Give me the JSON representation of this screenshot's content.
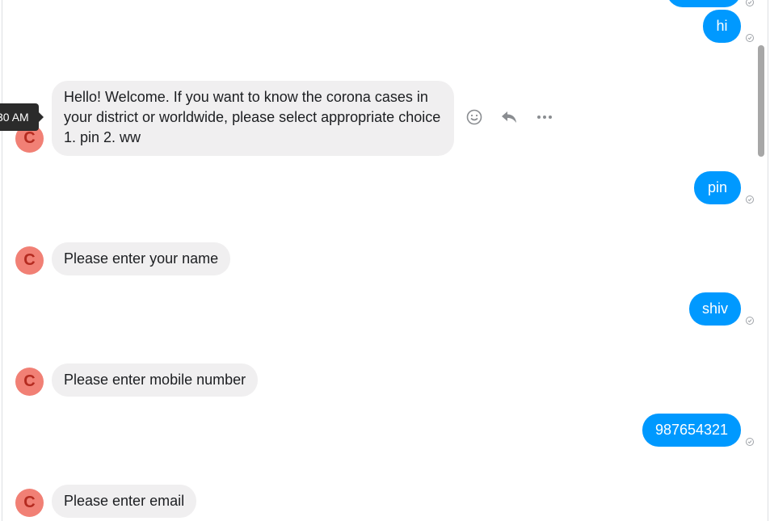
{
  "tooltip": {
    "time": "30 AM"
  },
  "avatar_initial": "C",
  "messages": {
    "out_hi": "hi",
    "bot_welcome": "Hello! Welcome. If you want to know the corona cases in your district or worldwide, please select appropriate choice  1. pin  2. ww",
    "out_pin": "pin",
    "bot_name": "Please enter your name",
    "out_shiv": "shiv",
    "bot_mobile": "Please enter mobile number",
    "out_number": "987654321",
    "bot_email": "Please enter email"
  },
  "icons": {
    "react": "smiley-icon",
    "reply": "reply-icon",
    "more": "more-icon",
    "read": "read-check-icon"
  },
  "colors": {
    "outgoing": "#0099ff",
    "incoming": "#f0eff0",
    "avatar": "#f18075"
  }
}
